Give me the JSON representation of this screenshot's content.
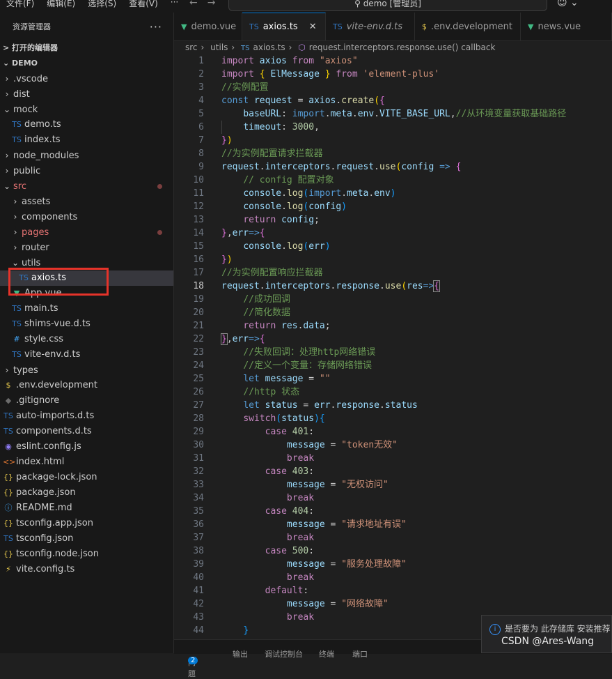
{
  "menu": [
    "文件(F)",
    "编辑(E)",
    "选择(S)",
    "查看(V)",
    "···"
  ],
  "search": {
    "text": "demo [管理员]"
  },
  "sidebar": {
    "title": "资源管理器",
    "open_editors": "打开的编辑器",
    "root": "DEMO",
    "items": [
      {
        "label": ".vscode",
        "kind": "folder",
        "state": "collapsed"
      },
      {
        "label": "dist",
        "kind": "folder",
        "state": "collapsed"
      },
      {
        "label": "mock",
        "kind": "folder",
        "state": "expanded"
      },
      {
        "label": "demo.ts",
        "kind": "ts"
      },
      {
        "label": "index.ts",
        "kind": "ts"
      },
      {
        "label": "node_modules",
        "kind": "folder",
        "state": "collapsed"
      },
      {
        "label": "public",
        "kind": "folder",
        "state": "collapsed"
      },
      {
        "label": "src",
        "kind": "folder",
        "state": "expanded",
        "modified": true
      },
      {
        "label": "assets",
        "kind": "folder",
        "state": "collapsed"
      },
      {
        "label": "components",
        "kind": "folder",
        "state": "collapsed"
      },
      {
        "label": "pages",
        "kind": "folder",
        "state": "collapsed",
        "modified": true
      },
      {
        "label": "router",
        "kind": "folder",
        "state": "collapsed"
      },
      {
        "label": "utils",
        "kind": "folder",
        "state": "expanded"
      },
      {
        "label": "axios.ts",
        "kind": "ts",
        "selected": true
      },
      {
        "label": "App.vue",
        "kind": "vue"
      },
      {
        "label": "main.ts",
        "kind": "ts"
      },
      {
        "label": "shims-vue.d.ts",
        "kind": "ts"
      },
      {
        "label": "style.css",
        "kind": "css"
      },
      {
        "label": "vite-env.d.ts",
        "kind": "ts"
      },
      {
        "label": "types",
        "kind": "folder",
        "state": "collapsed"
      },
      {
        "label": ".env.development",
        "kind": "env"
      },
      {
        "label": ".gitignore",
        "kind": "git"
      },
      {
        "label": "auto-imports.d.ts",
        "kind": "ts"
      },
      {
        "label": "components.d.ts",
        "kind": "ts"
      },
      {
        "label": "eslint.config.js",
        "kind": "eslint"
      },
      {
        "label": "index.html",
        "kind": "html"
      },
      {
        "label": "package-lock.json",
        "kind": "json"
      },
      {
        "label": "package.json",
        "kind": "json"
      },
      {
        "label": "README.md",
        "kind": "md"
      },
      {
        "label": "tsconfig.app.json",
        "kind": "json"
      },
      {
        "label": "tsconfig.json",
        "kind": "tsjson"
      },
      {
        "label": "tsconfig.node.json",
        "kind": "json"
      },
      {
        "label": "vite.config.ts",
        "kind": "vite"
      }
    ]
  },
  "tabs": [
    {
      "label": "demo.vue",
      "icon": "vue"
    },
    {
      "label": "axios.ts",
      "icon": "TS",
      "active": true
    },
    {
      "label": "vite-env.d.ts",
      "icon": "TS"
    },
    {
      "label": ".env.development",
      "icon": "$"
    },
    {
      "label": "news.vue",
      "icon": "vue"
    }
  ],
  "breadcrumb": [
    "src",
    "utils",
    "axios.ts",
    "request.interceptors.response.use() callback"
  ],
  "editor": {
    "current_line": 18
  },
  "panel": {
    "problems": "问题",
    "problems_count": "2",
    "output": "输出",
    "debug": "调试控制台",
    "terminal": "终端",
    "ports": "端口"
  },
  "notification": {
    "text": "是否要为 此存储库 安装推荐"
  },
  "watermark": "CSDN @Ares-Wang"
}
